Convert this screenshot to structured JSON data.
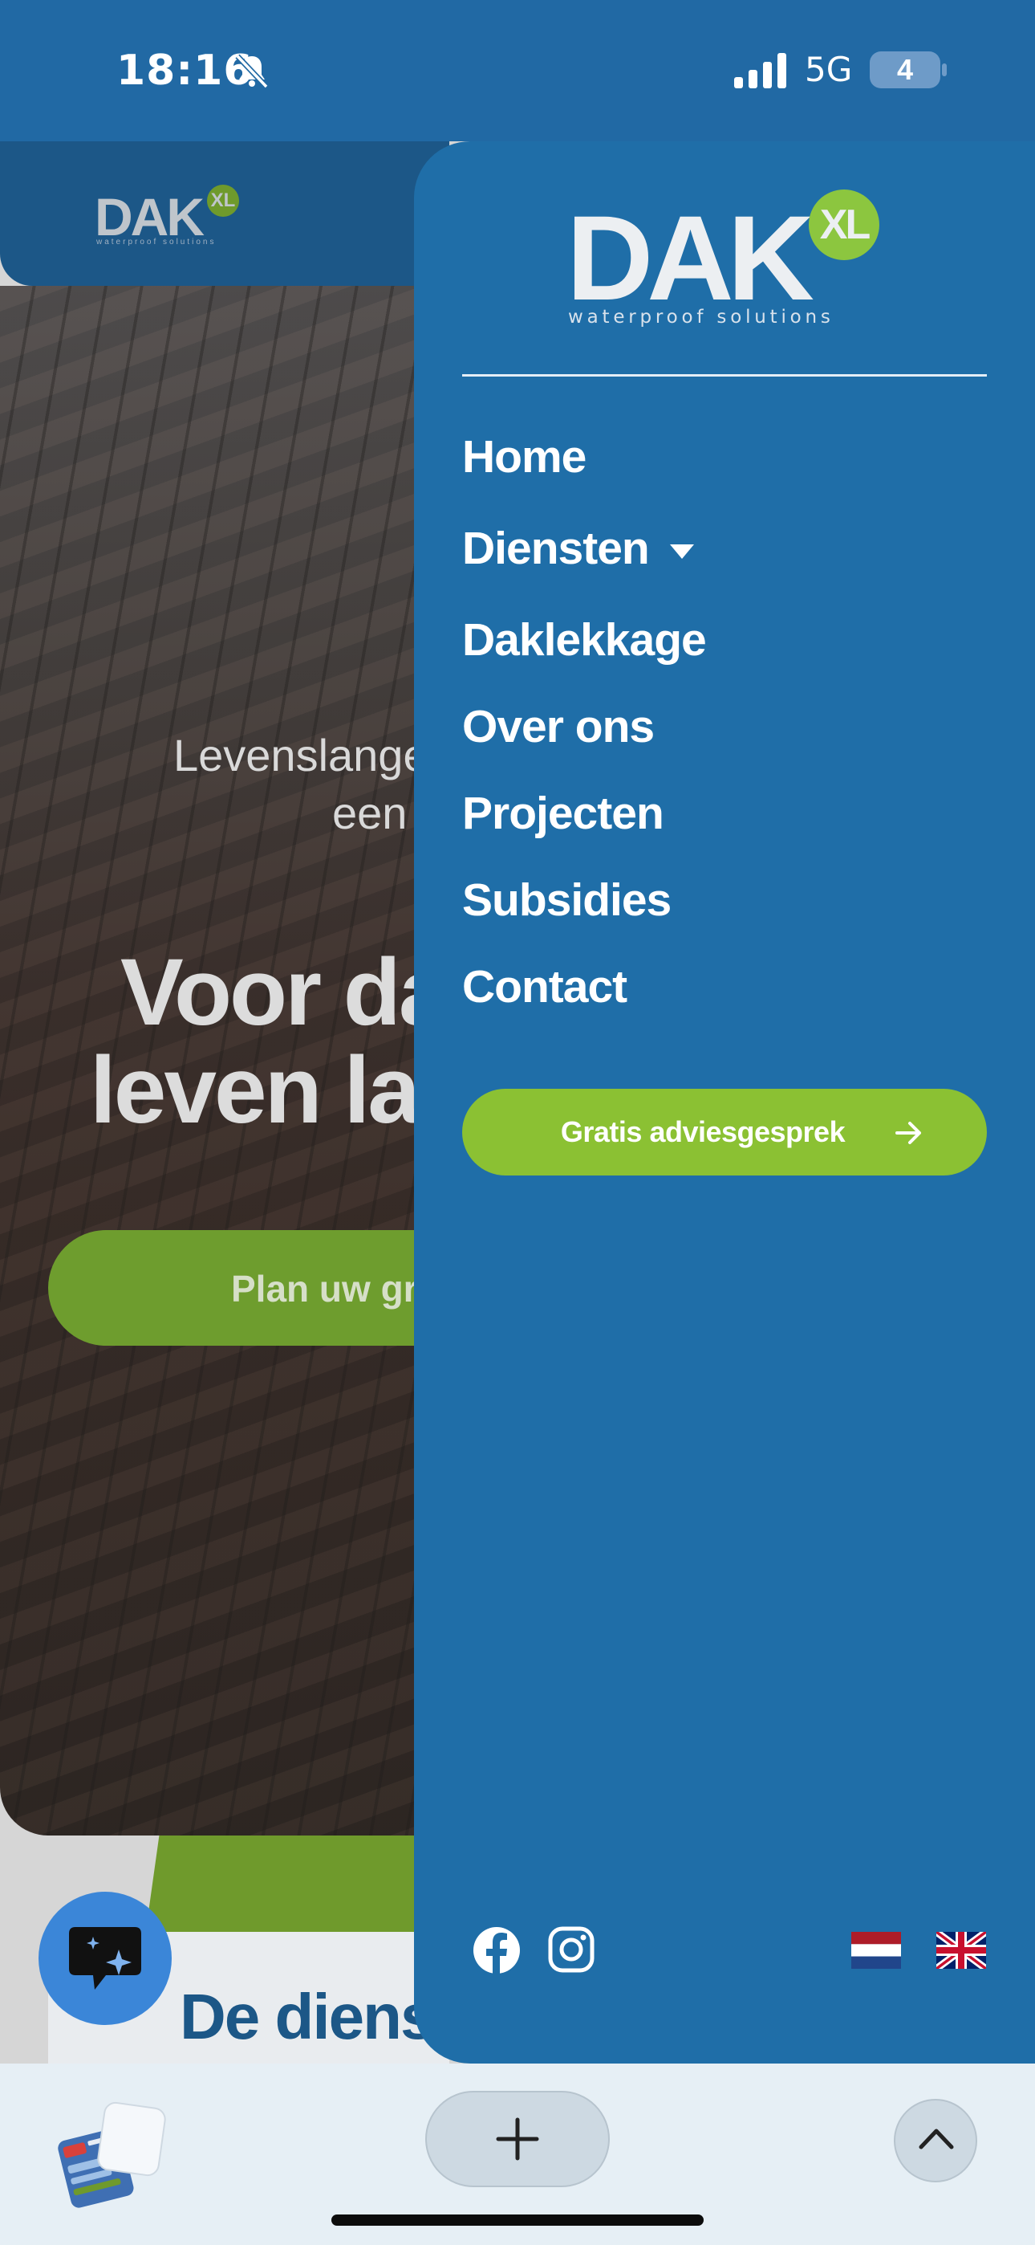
{
  "status_bar": {
    "time": "18:16",
    "network": "5G",
    "battery": "4"
  },
  "background_page": {
    "logo": {
      "word": "DAK",
      "badge": "XL",
      "tagline": "waterproof solutions"
    },
    "hero": {
      "subline_1": "Levenslange",
      "subline_2": "een",
      "heading_line_1": "Voor da",
      "heading_line_2": "leven lan",
      "cta_label": "Plan uw gra"
    },
    "section_title": "De dienst"
  },
  "drawer": {
    "logo": {
      "word": "DAK",
      "badge": "XL",
      "tagline": "waterproof solutions"
    },
    "nav": [
      {
        "label": "Home"
      },
      {
        "label": "Diensten",
        "has_submenu": true
      },
      {
        "label": "Daklekkage"
      },
      {
        "label": "Over ons"
      },
      {
        "label": "Projecten"
      },
      {
        "label": "Subsidies"
      },
      {
        "label": "Contact"
      }
    ],
    "cta_label": "Gratis adviesgesprek",
    "social": [
      "facebook-icon",
      "instagram-icon"
    ],
    "languages": [
      "nl",
      "en"
    ]
  },
  "colors": {
    "brand_blue": "#1f6ea8",
    "brand_green": "#8bc133",
    "header_blue": "#1c5787"
  }
}
